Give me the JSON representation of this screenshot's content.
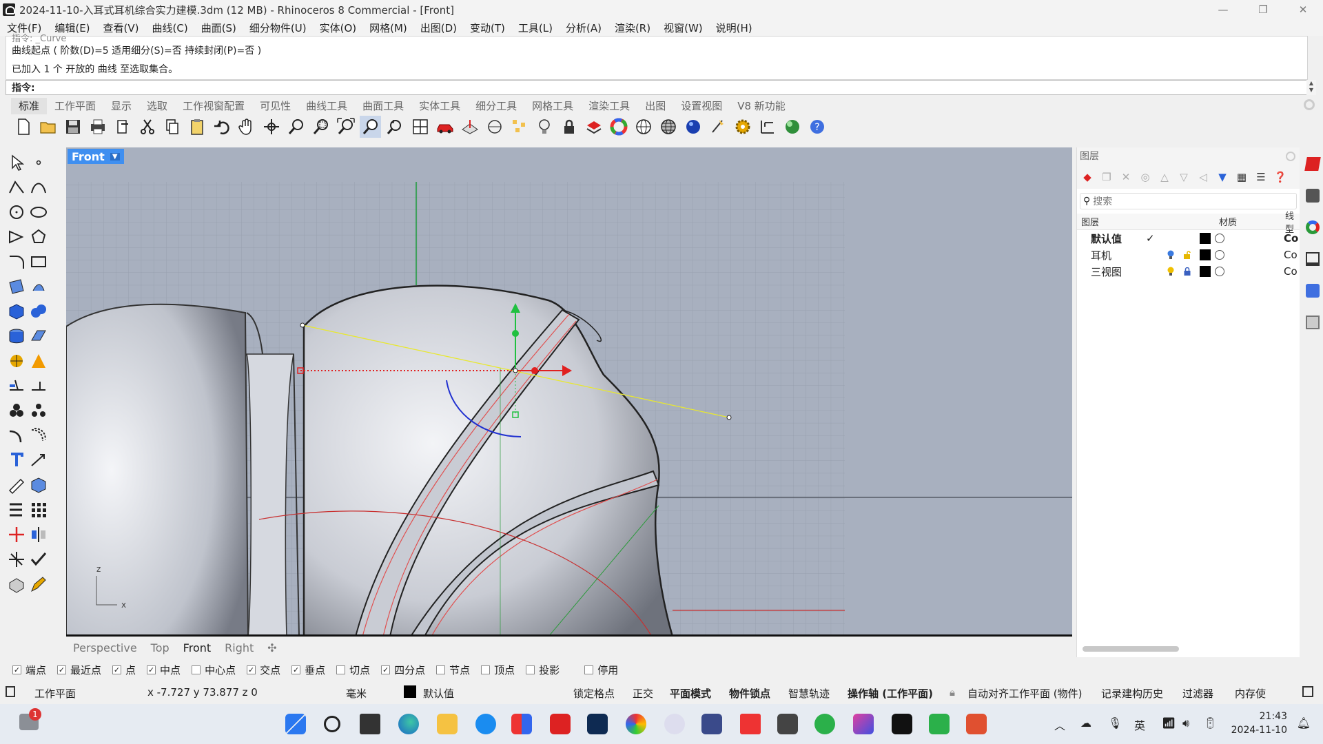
{
  "window": {
    "title": "2024-11-10-入耳式耳机综合实力建模.3dm (12 MB) - Rhinoceros 8 Commercial - [Front]"
  },
  "menu": [
    "文件(F)",
    "编辑(E)",
    "查看(V)",
    "曲线(C)",
    "曲面(S)",
    "细分物件(U)",
    "实体(O)",
    "网格(M)",
    "出图(D)",
    "变动(T)",
    "工具(L)",
    "分析(A)",
    "渲染(R)",
    "视窗(W)",
    "说明(H)"
  ],
  "command": {
    "partial": "指令: _Curve",
    "line1": "曲线起点 ( 阶数(D)=5  适用细分(S)=否  持续封闭(P)=否 )",
    "line2": "已加入 1 个 开放的 曲线 至选取集合。",
    "prompt": "指令:",
    "value": ""
  },
  "tabs": [
    "标准",
    "工作平面",
    "显示",
    "选取",
    "工作视窗配置",
    "可见性",
    "曲线工具",
    "曲面工具",
    "实体工具",
    "细分工具",
    "网格工具",
    "渲染工具",
    "出图",
    "设置视图",
    "V8 新功能"
  ],
  "viewport": {
    "name": "Front",
    "axis_z": "z",
    "axis_x": "x"
  },
  "viewtabs": [
    "Perspective",
    "Top",
    "Front",
    "Right"
  ],
  "layers": {
    "title": "图层",
    "search_placeholder": "搜索",
    "col_layer": "图层",
    "col_material": "材质",
    "col_linetype": "线型",
    "rows": [
      {
        "name": "默认值",
        "current": "✓",
        "linetype": "Co"
      },
      {
        "name": "耳机",
        "linetype": "Co"
      },
      {
        "name": "三视图",
        "linetype": "Co"
      }
    ]
  },
  "osnap": [
    {
      "label": "端点",
      "checked": true
    },
    {
      "label": "最近点",
      "checked": true
    },
    {
      "label": "点",
      "checked": true
    },
    {
      "label": "中点",
      "checked": true
    },
    {
      "label": "中心点",
      "checked": false
    },
    {
      "label": "交点",
      "checked": true
    },
    {
      "label": "垂点",
      "checked": true
    },
    {
      "label": "切点",
      "checked": false
    },
    {
      "label": "四分点",
      "checked": true
    },
    {
      "label": "节点",
      "checked": false
    },
    {
      "label": "顶点",
      "checked": false
    },
    {
      "label": "投影",
      "checked": false
    },
    {
      "label": "停用",
      "checked": false
    }
  ],
  "status": {
    "cplane": "工作平面",
    "coords": "x -7.727  y 73.877  z 0",
    "units": "毫米",
    "layer": "默认值",
    "grid_snap": "锁定格点",
    "ortho": "正交",
    "planar": "平面模式",
    "osnap": "物件锁点",
    "smarttrack": "智慧轨迹",
    "gumball": "操作轴 (工作平面)",
    "autoalign": "自动对齐工作平面 (物件)",
    "history": "记录建构历史",
    "filter": "过滤器",
    "memory": "内存使"
  },
  "taskbar": {
    "time": "21:43",
    "date": "2024-11-10",
    "ime": "英",
    "badge": "1"
  },
  "colors": {
    "accent": "#3f8ff0",
    "viewport_bg": "#a8b0bf",
    "grid": "#9aa2b2"
  }
}
